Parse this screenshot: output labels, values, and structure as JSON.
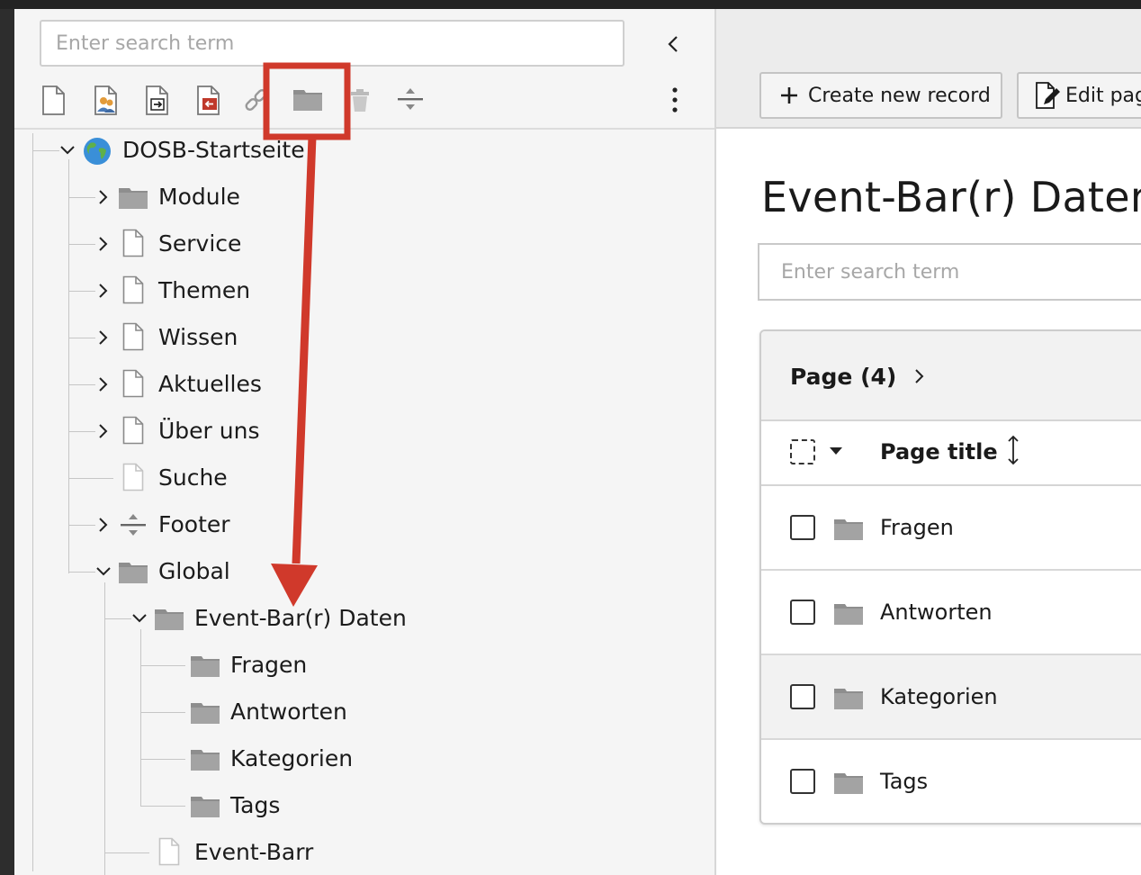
{
  "page_tree": {
    "search_placeholder": "Enter search term",
    "toolbar": {
      "icons": [
        "new-page-icon",
        "new-page-user-icon",
        "new-shortcut-page-icon",
        "new-link-page-icon",
        "new-external-link-icon",
        "new-folder-icon",
        "recycler-icon",
        "new-divider-icon",
        "more-actions-icon"
      ]
    },
    "nodes": [
      {
        "label": "DOSB-Startseite",
        "icon": "globe-site-root-icon",
        "expanded": true
      },
      {
        "label": "Module",
        "icon": "folder-icon",
        "expanded": false
      },
      {
        "label": "Service",
        "icon": "page-icon",
        "expanded": false
      },
      {
        "label": "Themen",
        "icon": "page-icon",
        "expanded": false
      },
      {
        "label": "Wissen",
        "icon": "page-icon",
        "expanded": false
      },
      {
        "label": "Aktuelles",
        "icon": "page-icon",
        "expanded": false
      },
      {
        "label": "Über uns",
        "icon": "page-icon",
        "expanded": false
      },
      {
        "label": "Suche",
        "icon": "page-hidden-icon"
      },
      {
        "label": "Footer",
        "icon": "divider-icon",
        "expanded": false
      },
      {
        "label": "Global",
        "icon": "folder-icon",
        "expanded": true
      },
      {
        "label": "Event-Bar(r) Daten",
        "icon": "folder-icon",
        "expanded": true
      },
      {
        "label": "Fragen",
        "icon": "folder-icon"
      },
      {
        "label": "Antworten",
        "icon": "folder-icon"
      },
      {
        "label": "Kategorien",
        "icon": "folder-icon"
      },
      {
        "label": "Tags",
        "icon": "folder-icon"
      },
      {
        "label": "Event-Barr",
        "icon": "page-hidden-icon"
      }
    ]
  },
  "content": {
    "buttons": {
      "create_new_record": "Create new record",
      "edit_page": "Edit page"
    },
    "title": "Event-Bar(r) Daten",
    "search_placeholder": "Enter search term",
    "table": {
      "header": "Page (4)",
      "column_title": "Page title",
      "rows": [
        {
          "title": "Fragen",
          "icon": "folder-icon"
        },
        {
          "title": "Antworten",
          "icon": "folder-icon"
        },
        {
          "title": "Kategorien",
          "icon": "folder-icon"
        },
        {
          "title": "Tags",
          "icon": "folder-icon"
        }
      ]
    }
  },
  "annotation": {
    "highlight_color": "#d0392b",
    "highlighted_icon": "new-folder-icon"
  }
}
